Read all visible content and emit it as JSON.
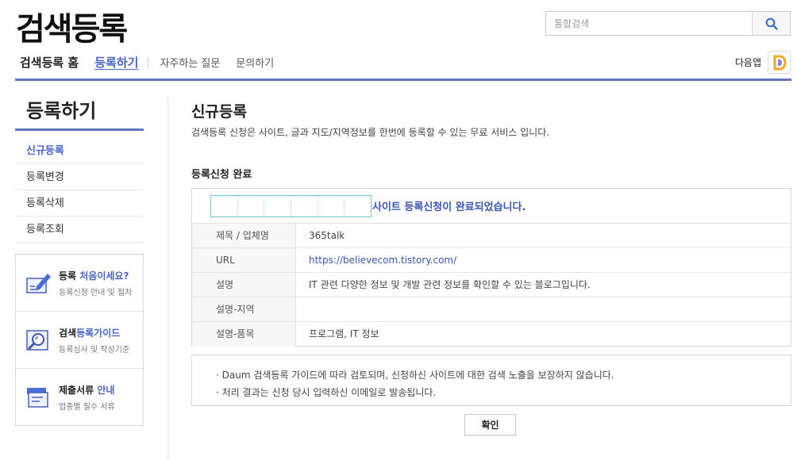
{
  "header": {
    "logo": "검색등록",
    "search_placeholder": "통합검색",
    "daum_app_label": "다음앱",
    "nav": {
      "home": "검색등록 홈",
      "active": "등록하기",
      "items": [
        "자주하는 질문",
        "문의하기"
      ]
    }
  },
  "sidebar": {
    "title": "등록하기",
    "menu": [
      "신규등록",
      "등록변경",
      "등록삭제",
      "등록조회"
    ],
    "promos": [
      {
        "title_a": "등록 ",
        "title_b": "처음이세요?",
        "desc": "등록신청 안내 및 절차"
      },
      {
        "title_a": "검색",
        "title_b": "등록가이드",
        "desc": "등록심사 및 작성기준"
      },
      {
        "title_a": "제출서류 ",
        "title_b": "안내",
        "desc": "업종별 필수 서류"
      }
    ]
  },
  "main": {
    "title": "신규등록",
    "description": "검색등록 신청은 사이트, 글과 지도/지역정보를 한번에 등록할 수 있는 무료 서비스 입니다.",
    "section_title": "등록신청 완료",
    "result_message": "사이트 등록신청이 완료되었습니다.",
    "rows": [
      {
        "label": "제목 / 업체명",
        "value": "365talk"
      },
      {
        "label": "URL",
        "value": "https://believecom.tistory.com/"
      },
      {
        "label": "설명",
        "value": "IT 관련 다양한 정보 및 개발 관련 정보를 확인할 수 있는 블로그입니다."
      },
      {
        "label": "설명-지역",
        "value": ""
      },
      {
        "label": "설명-품목",
        "value": "프로그램, IT 정보"
      }
    ],
    "notices": [
      "· Daum 검색등록 가이드에 따라 검토되며, 신청하신 사이트에 대한 검색 노출을 보장하지 않습니다.",
      "· 처리 결과는 신청 당시 입력하신 이메일로 발송됩니다."
    ],
    "confirm_label": "확인"
  },
  "colors": {
    "accent": "#6173c0",
    "link": "#3c55b5",
    "daum_d": "#f5a623"
  },
  "icons": {
    "search": "search-icon",
    "daum": "daum-d-logo",
    "promo": [
      "pencil-note-icon",
      "magnifier-guide-icon",
      "documents-icon"
    ]
  }
}
